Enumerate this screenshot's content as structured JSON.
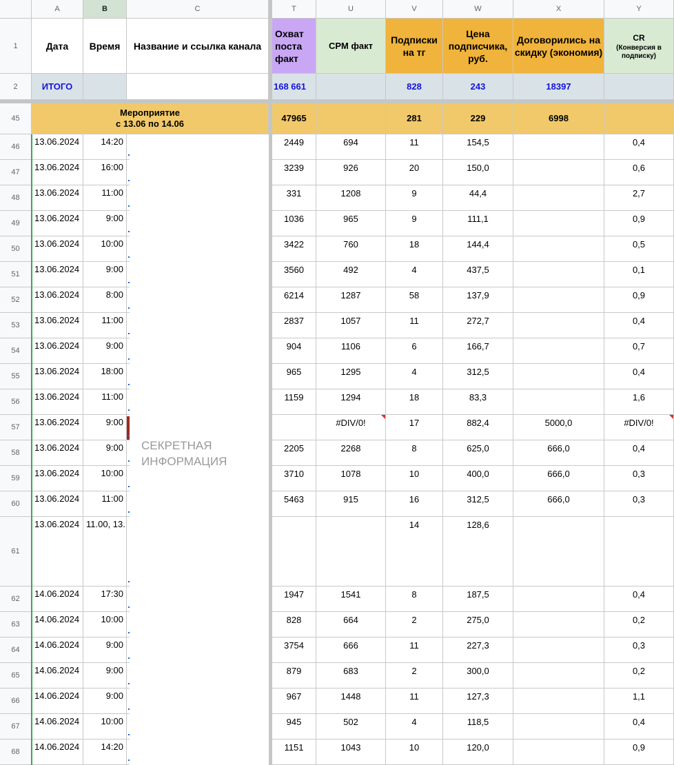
{
  "columns": [
    "A",
    "B",
    "C",
    "T",
    "U",
    "V",
    "W",
    "X",
    "Y"
  ],
  "headers": {
    "date": "Дата",
    "time": "Время",
    "channel": "Название и ссылка канала",
    "reach": "Охват поста факт",
    "cpm": "CPM факт",
    "subs": "Подписки на тг",
    "price": "Цена подписчика, руб.",
    "discount": "Договорились на скидку (экономия)",
    "cr": "CR",
    "cr_sub": "(Конверсия в подписку)"
  },
  "totals": {
    "row": "2",
    "label": "ИТОГО",
    "reach": "168 661",
    "subs": "828",
    "price": "243",
    "discount": "18397"
  },
  "event": {
    "row": "45",
    "title": "Мероприятие",
    "dates": "с 13.06 по 14.06",
    "reach": "47965",
    "subs": "281",
    "price": "229",
    "discount": "6998"
  },
  "redaction": "СЕКРЕТНАЯ\nИНФОРМАЦИЯ",
  "rows": [
    {
      "n": "46",
      "date": "13.06.2024",
      "time": "14:20",
      "c": "Н",
      "reach": "2449",
      "cpm": "694",
      "subs": "11",
      "price": "154,5",
      "disc": "",
      "cr": "0,4"
    },
    {
      "n": "47",
      "date": "13.06.2024",
      "time": "16:00",
      "c": "Н",
      "reach": "3239",
      "cpm": "926",
      "subs": "20",
      "price": "150,0",
      "disc": "",
      "cr": "0,6"
    },
    {
      "n": "48",
      "date": "13.06.2024",
      "time": "11:00",
      "c": "П",
      "reach": "331",
      "cpm": "1208",
      "subs": "9",
      "price": "44,4",
      "disc": "",
      "cr": "2,7"
    },
    {
      "n": "49",
      "date": "13.06.2024",
      "time": "9:00",
      "c": "",
      "reach": "1036",
      "cpm": "965",
      "subs": "9",
      "price": "111,1",
      "disc": "",
      "cr": "0,9"
    },
    {
      "n": "50",
      "date": "13.06.2024",
      "time": "10:00",
      "c": "П",
      "reach": "3422",
      "cpm": "760",
      "subs": "18",
      "price": "144,4",
      "disc": "",
      "cr": "0,5"
    },
    {
      "n": "51",
      "date": "13.06.2024",
      "time": "9:00",
      "c": "Д",
      "reach": "3560",
      "cpm": "492",
      "subs": "4",
      "price": "437,5",
      "disc": "",
      "cr": "0,1"
    },
    {
      "n": "52",
      "date": "13.06.2024",
      "time": "8:00",
      "c": "n",
      "reach": "6214",
      "cpm": "1287",
      "subs": "58",
      "price": "137,9",
      "disc": "",
      "cr": "0,9"
    },
    {
      "n": "53",
      "date": "13.06.2024",
      "time": "11:00",
      "c": "У",
      "reach": "2837",
      "cpm": "1057",
      "subs": "11",
      "price": "272,7",
      "disc": "",
      "cr": "0,4"
    },
    {
      "n": "54",
      "date": "13.06.2024",
      "time": "9:00",
      "c": "С",
      "reach": "904",
      "cpm": "1106",
      "subs": "6",
      "price": "166,7",
      "disc": "",
      "cr": "0,7"
    },
    {
      "n": "55",
      "date": "13.06.2024",
      "time": "18:00",
      "c": "С",
      "reach": "965",
      "cpm": "1295",
      "subs": "4",
      "price": "312,5",
      "disc": "",
      "cr": "0,4"
    },
    {
      "n": "56",
      "date": "13.06.2024",
      "time": "11:00",
      "c": "С",
      "reach": "1159",
      "cpm": "1294",
      "subs": "18",
      "price": "83,3",
      "disc": "",
      "cr": "1,6"
    },
    {
      "n": "57",
      "date": "13.06.2024",
      "time": "9:00",
      "c": "",
      "reach": "",
      "cpm": "#DIV/0!",
      "subs": "17",
      "price": "882,4",
      "disc": "5000,0",
      "cr": "#DIV/0!"
    },
    {
      "n": "58",
      "date": "13.06.2024",
      "time": "9:00",
      "c": "П",
      "reach": "2205",
      "cpm": "2268",
      "subs": "8",
      "price": "625,0",
      "disc": "666,0",
      "cr": "0,4"
    },
    {
      "n": "59",
      "date": "13.06.2024",
      "time": "10:00",
      "c": "У",
      "reach": "3710",
      "cpm": "1078",
      "subs": "10",
      "price": "400,0",
      "disc": "666,0",
      "cr": "0,3"
    },
    {
      "n": "60",
      "date": "13.06.2024",
      "time": "11:00",
      "c": "Н",
      "reach": "5463",
      "cpm": "915",
      "subs": "16",
      "price": "312,5",
      "disc": "666,0",
      "cr": "0,3"
    },
    {
      "n": "61",
      "date": "13.06.2024",
      "time": "11.00, 13.",
      "c": "Ч",
      "reach": "",
      "cpm": "",
      "subs": "14",
      "price": "128,6",
      "disc": "",
      "cr": ""
    },
    {
      "n": "62",
      "date": "14.06.2024",
      "time": "17:30",
      "c": "Н",
      "reach": "1947",
      "cpm": "1541",
      "subs": "8",
      "price": "187,5",
      "disc": "",
      "cr": "0,4"
    },
    {
      "n": "63",
      "date": "14.06.2024",
      "time": "10:00",
      "c": "З",
      "reach": "828",
      "cpm": "664",
      "subs": "2",
      "price": "275,0",
      "disc": "",
      "cr": "0,2"
    },
    {
      "n": "64",
      "date": "14.06.2024",
      "time": "9:00",
      "c": "Н",
      "reach": "3754",
      "cpm": "666",
      "subs": "11",
      "price": "227,3",
      "disc": "",
      "cr": "0,3"
    },
    {
      "n": "65",
      "date": "14.06.2024",
      "time": "9:00",
      "c": "Р",
      "reach": "879",
      "cpm": "683",
      "subs": "2",
      "price": "300,0",
      "disc": "",
      "cr": "0,2"
    },
    {
      "n": "66",
      "date": "14.06.2024",
      "time": "9:00",
      "c": "И",
      "reach": "967",
      "cpm": "1448",
      "subs": "11",
      "price": "127,3",
      "disc": "",
      "cr": "1,1"
    },
    {
      "n": "67",
      "date": "14.06.2024",
      "time": "10:00",
      "c": "С",
      "reach": "945",
      "cpm": "502",
      "subs": "4",
      "price": "118,5",
      "disc": "",
      "cr": "0,4"
    },
    {
      "n": "68",
      "date": "14.06.2024",
      "time": "14:20",
      "c": "Х",
      "reach": "1151",
      "cpm": "1043",
      "subs": "10",
      "price": "120,0",
      "disc": "",
      "cr": "0,9"
    }
  ],
  "header_row": "1",
  "colors": {
    "reach_header": "#c9a7f5",
    "header_green": "#d9ead3",
    "header_orange": "#f0b33b",
    "event": "#f1c96b",
    "total": "#d9e2e7",
    "total_text": "#1414d6"
  }
}
